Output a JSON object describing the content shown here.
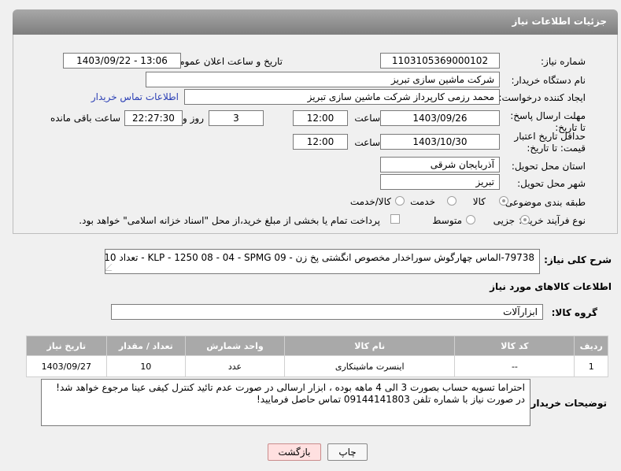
{
  "header": {
    "title": "جزئیات اطلاعات نیاز"
  },
  "fields": {
    "need_number_label": "شماره نیاز:",
    "need_number": "1103105369000102",
    "announce_label": "تاریخ و ساعت اعلان عمومی:",
    "announce_value": "1403/09/22 - 13:06",
    "buyer_org_label": "نام دستگاه خریدار:",
    "buyer_org": "شرکت ماشین سازی تبریز",
    "creator_label": "ایجاد کننده درخواست:",
    "creator": "محمد رزمی کارپرداز شرکت ماشین سازی تبریز",
    "buyer_contact_link": "اطلاعات تماس خریدار",
    "reply_deadline_label": "مهلت ارسال پاسخ: تا تاریخ:",
    "reply_date": "1403/09/26",
    "time_label": "ساعت",
    "reply_time": "12:00",
    "days_value": "3",
    "days_label": "روز و",
    "remaining_time": "22:27:30",
    "remaining_label": "ساعت باقی مانده",
    "price_validity_label": "حداقل تاریخ اعتبار قیمت: تا تاریخ:",
    "validity_date": "1403/10/30",
    "validity_time": "12:00",
    "province_label": "استان محل تحویل:",
    "province": "آذربایجان شرقی",
    "city_label": "شهر محل تحویل:",
    "city": "تبریز",
    "category_label": "طبقه بندی موضوعی:",
    "category_options": [
      "کالا",
      "خدمت",
      "کالا/خدمت"
    ],
    "purchase_type_label": "نوع فرآیند خرید :",
    "purchase_options": [
      "جزیی",
      "متوسط"
    ],
    "treasury_note": "پرداخت تمام یا بخشی از مبلغ خرید،از محل \"اسناد خزانه اسلامی\" خواهد بود."
  },
  "summary": {
    "label": "شرح کلی نیاز:",
    "text": "79738-الماس چهارگوش سوراخدار مخصوص انگشتی پخ زن - KLP - 1250  08 - 04 - SPMG 09 - تعداد 10 عدد"
  },
  "goods_section_title": "اطلاعات کالاهای مورد نیاز",
  "goods_group": {
    "label": "گروه کالا:",
    "value": "ابزارآلات"
  },
  "table": {
    "headers": [
      "ردیف",
      "کد کالا",
      "نام کالا",
      "واحد شمارش",
      "تعداد / مقدار",
      "تاریخ نیاز"
    ],
    "rows": [
      [
        "1",
        "--",
        "اینسرت ماشینکاری",
        "عدد",
        "10",
        "1403/09/27"
      ]
    ]
  },
  "buyer_notes": {
    "label": "توضیحات خریدار:",
    "text": "احتراما تسویه حساب بصورت 3 الی 4 ماهه بوده ، ابزار ارسالی در صورت عدم تائید کنترل کیفی عینا مرجوع خواهد شد! در صورت نیاز با شماره تلفن 09144141803 تماس حاصل فرمایید!"
  },
  "buttons": {
    "print": "چاپ",
    "back": "بازگشت"
  }
}
